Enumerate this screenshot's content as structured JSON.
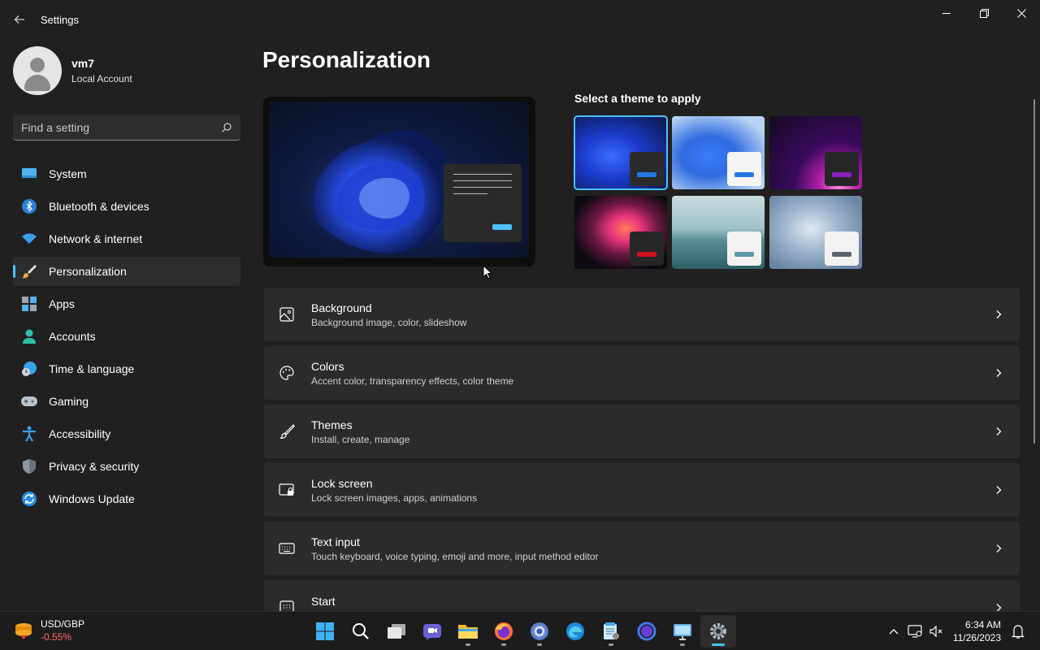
{
  "window": {
    "title": "Settings"
  },
  "profile": {
    "name": "vm7",
    "account_type": "Local Account"
  },
  "search": {
    "placeholder": "Find a setting"
  },
  "nav": {
    "items": [
      {
        "label": "System",
        "icon": "monitor-icon"
      },
      {
        "label": "Bluetooth & devices",
        "icon": "bluetooth-icon"
      },
      {
        "label": "Network & internet",
        "icon": "wifi-icon"
      },
      {
        "label": "Personalization",
        "icon": "brush-icon",
        "active": true
      },
      {
        "label": "Apps",
        "icon": "apps-icon"
      },
      {
        "label": "Accounts",
        "icon": "person-icon"
      },
      {
        "label": "Time & language",
        "icon": "clock-globe-icon"
      },
      {
        "label": "Gaming",
        "icon": "gamepad-icon"
      },
      {
        "label": "Accessibility",
        "icon": "accessibility-icon"
      },
      {
        "label": "Privacy & security",
        "icon": "shield-icon"
      },
      {
        "label": "Windows Update",
        "icon": "update-icon"
      }
    ]
  },
  "main": {
    "title": "Personalization",
    "themes_label": "Select a theme to apply",
    "cards": [
      {
        "title": "Background",
        "subtitle": "Background image, color, slideshow",
        "icon": "image-icon"
      },
      {
        "title": "Colors",
        "subtitle": "Accent color, transparency effects, color theme",
        "icon": "palette-icon"
      },
      {
        "title": "Themes",
        "subtitle": "Install, create, manage",
        "icon": "brush-icon"
      },
      {
        "title": "Lock screen",
        "subtitle": "Lock screen images, apps, animations",
        "icon": "lock-screen-icon"
      },
      {
        "title": "Text input",
        "subtitle": "Touch keyboard, voice typing, emoji and more, input method editor",
        "icon": "keyboard-icon"
      },
      {
        "title": "Start",
        "subtitle": "",
        "icon": "start-icon"
      }
    ]
  },
  "taskbar": {
    "widget": {
      "title": "USD/GBP",
      "value": "-0.55%"
    },
    "time": "6:34 AM",
    "date": "11/26/2023"
  },
  "colors": {
    "accent": "#4cc2ff"
  }
}
